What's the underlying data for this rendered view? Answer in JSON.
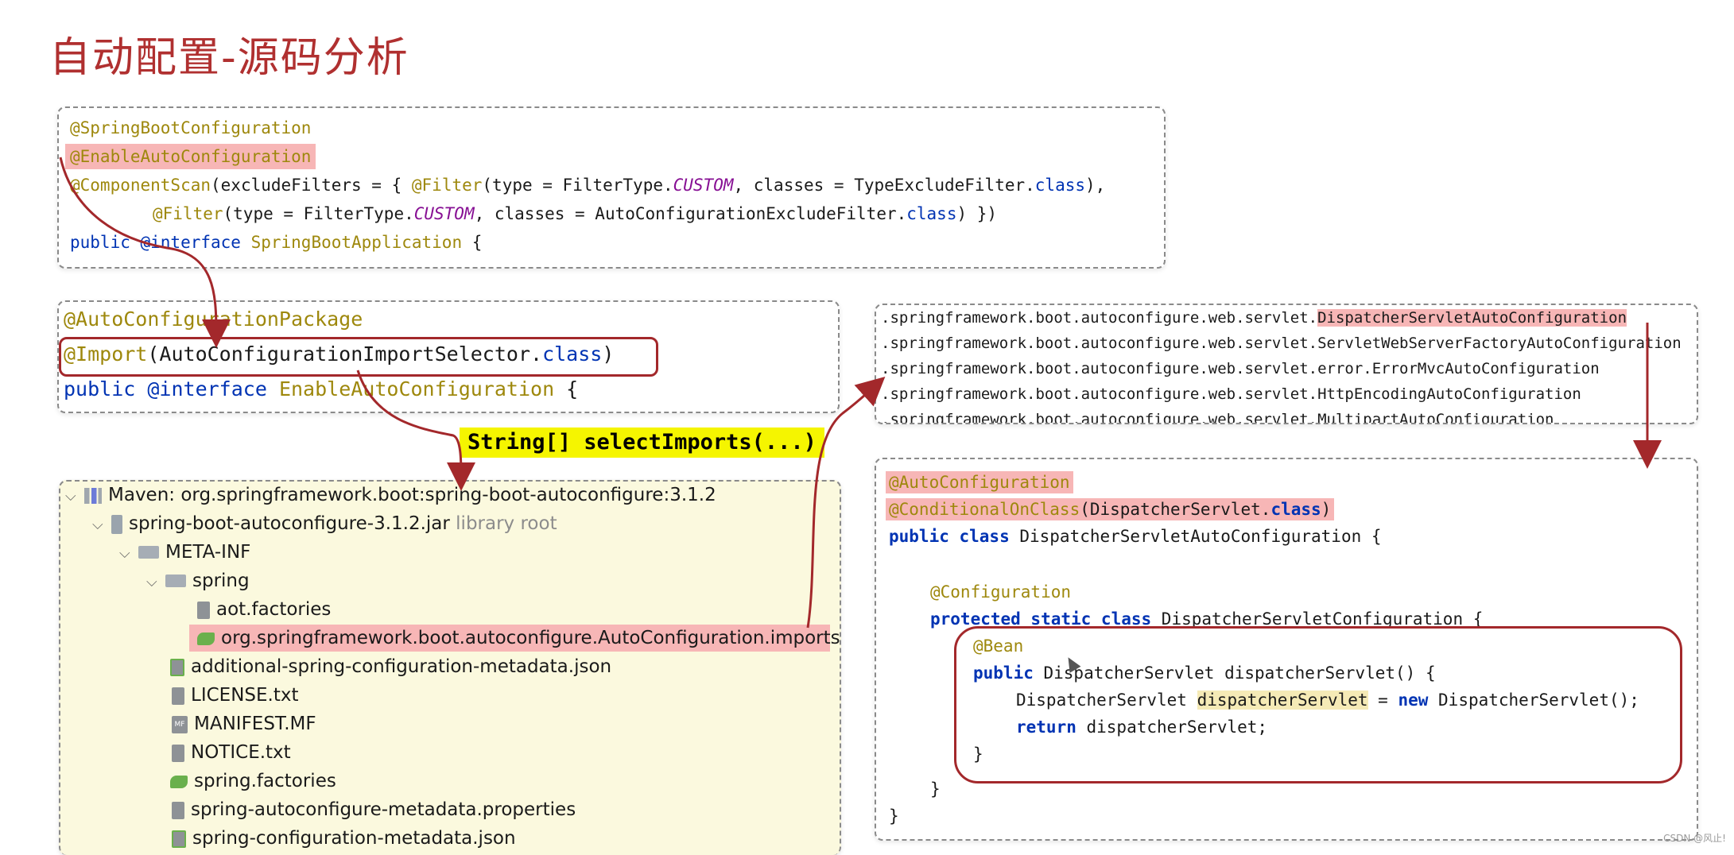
{
  "title": "自动配置-源码分析",
  "box1": {
    "line1": "@SpringBootConfiguration",
    "line2": "@EnableAutoConfiguration",
    "line3_ann": "@ComponentScan",
    "line3_a": "(excludeFilters = { ",
    "line3_filter": "@Filter",
    "line3_b": "(type = FilterType.",
    "line3_custom": "CUSTOM",
    "line3_c": ", classes = TypeExcludeFilter.",
    "line3_class": "class",
    "line3_d": "),",
    "line4_filter": "@Filter",
    "line4_b": "(type = FilterType.",
    "line4_custom": "CUSTOM",
    "line4_c": ", classes = AutoConfigurationExcludeFilter.",
    "line4_class": "class",
    "line4_d": ") })",
    "line5_kw": "public @interface",
    "line5_name": "SpringBootApplication",
    "line5_end": " {"
  },
  "box2": {
    "line1": "@AutoConfigurationPackage",
    "line2_ann": "@Import",
    "line2_a": "(AutoConfigurationImportSelector.",
    "line2_class": "class",
    "line2_b": ")",
    "line3_kw": "public @interface",
    "line3_name": "EnableAutoConfiguration",
    "line3_end": " {"
  },
  "select_imports": "String[] selectImports(...)",
  "tree": {
    "rows": [
      {
        "label": "Maven: org.springframework.boot:spring-boot-autoconfigure:3.1.2",
        "extra": ""
      },
      {
        "label": "spring-boot-autoconfigure-3.1.2.jar",
        "extra": "library root"
      },
      {
        "label": "META-INF",
        "extra": ""
      },
      {
        "label": "spring",
        "extra": ""
      },
      {
        "label": "aot.factories",
        "extra": ""
      },
      {
        "label": "org.springframework.boot.autoconfigure.AutoConfiguration.imports",
        "extra": ""
      },
      {
        "label": "additional-spring-configuration-metadata.json",
        "extra": ""
      },
      {
        "label": "LICENSE.txt",
        "extra": ""
      },
      {
        "label": "MANIFEST.MF",
        "extra": ""
      },
      {
        "label": "NOTICE.txt",
        "extra": ""
      },
      {
        "label": "spring.factories",
        "extra": ""
      },
      {
        "label": "spring-autoconfigure-metadata.properties",
        "extra": ""
      },
      {
        "label": "spring-configuration-metadata.json",
        "extra": ""
      }
    ],
    "mf_icon": "MF"
  },
  "imports_list": {
    "prefix": ".springframework.boot.autoconfigure.web.servlet.",
    "l1": "DispatcherServletAutoConfiguration",
    "l2": "ServletWebServerFactoryAutoConfiguration",
    "l3": "error.ErrorMvcAutoConfiguration",
    "l4": "HttpEncodingAutoConfiguration",
    "l5": "MultipartAutoConfiguration"
  },
  "box4": {
    "a1": "@AutoConfiguration",
    "a2_ann": "@ConditionalOnClass",
    "a2_body": "(DispatcherServlet.",
    "a2_class": "class",
    "a2_end": ")",
    "l3_kw": "public class",
    "l3_rest": " DispatcherServletAutoConfiguration {",
    "l5": "@Configuration",
    "l6_kw": "protected static class",
    "l6_rest": " DispatcherServletConfiguration {",
    "l7": "@Bean",
    "l8_kw": "public",
    "l8_rest": " DispatcherServlet dispatcherServlet() {",
    "l9_a": "DispatcherServlet ",
    "l9_hl": "dispatcherServlet",
    "l9_b": " = ",
    "l9_new": "new",
    "l9_c": " DispatcherServlet();",
    "l10_kw": "return",
    "l10_rest": " dispatcherServlet;",
    "close1": "}",
    "close2": "}",
    "close3": "}"
  },
  "watermark": "CSDN @风止!",
  "colors": {
    "title": "#b03030",
    "annotation": "#9e880d",
    "keyword": "#0033b3",
    "highlight_red": "#f7b6b6",
    "highlight_yellow": "#f5f500",
    "arrow": "#a3282b"
  }
}
